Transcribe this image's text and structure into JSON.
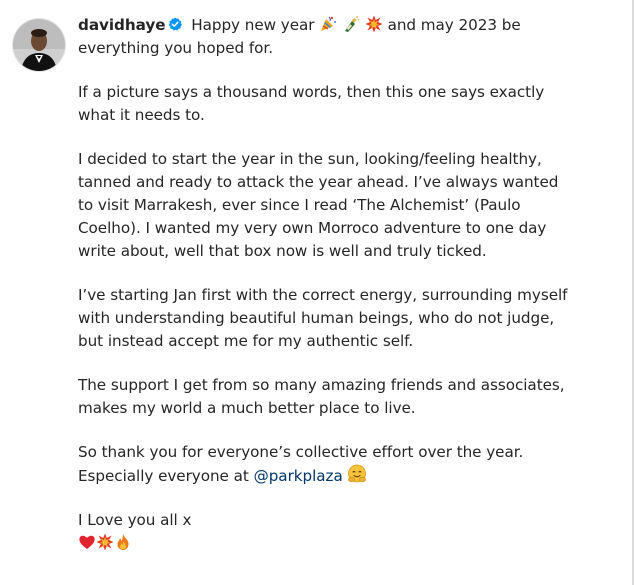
{
  "post": {
    "username": "davidhaye",
    "verified_icon": "verified-badge-icon",
    "line1_text": "Happy new year",
    "line1_emojis": [
      "party-popper-icon",
      "champagne-bottle-icon",
      "collision-icon"
    ],
    "line1_tail": "and may 2023 be everything you hoped for.",
    "para2": "If a picture says a thousand words, then this one says exactly what it needs to.",
    "para3": "I decided to start the year in the sun, looking/feeling healthy, tanned and ready to attack the year ahead. I’ve always wanted to visit Marrakesh, ever since I read ‘The Alchemist’ (Paulo Coelho). I wanted my very own Morroco adventure to one day write about, well that box now is well and truly ticked.",
    "para4": "I’ve starting Jan first with the correct energy, surrounding myself with understanding beautiful human beings, who do not judge, but instead accept me for my authentic self.",
    "para5": "The support I get from so many amazing friends and associates, makes my world a much better place to live.",
    "para6_line1": "So thank you for everyone’s collective effort over the year.",
    "para6_line2_prefix": "Especially everyone at",
    "mention": "@parkplaza",
    "para6_emoji": "smiling-face-with-hands-icon",
    "para7": "I Love you all x",
    "para7_emojis": [
      "red-heart-icon",
      "collision-icon",
      "fire-icon"
    ]
  },
  "colors": {
    "text": "#262626",
    "mention": "#00376b",
    "verified": "#0095f6",
    "divider": "#dbdbdb"
  }
}
